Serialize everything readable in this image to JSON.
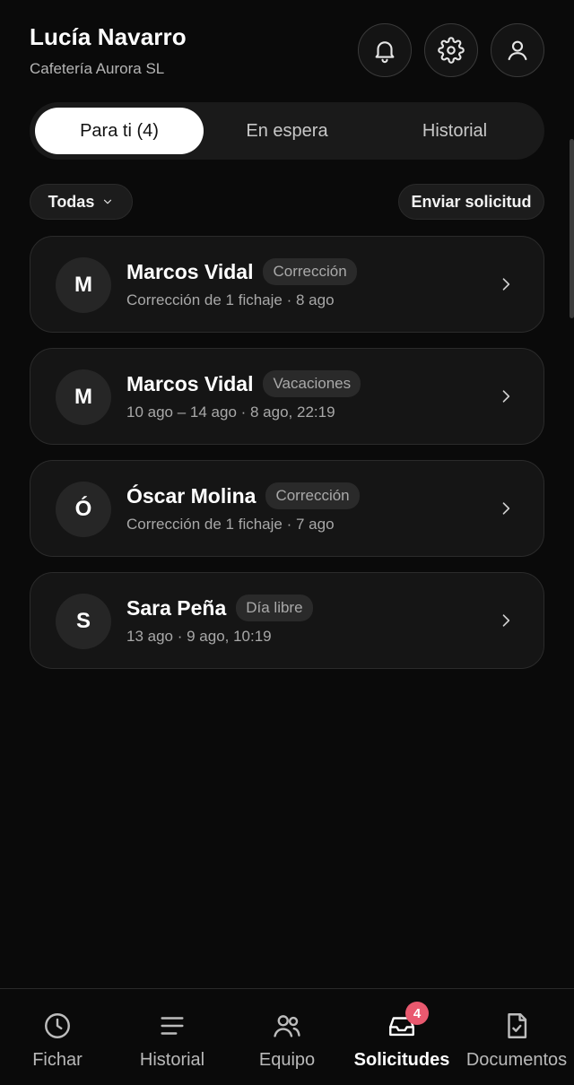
{
  "header": {
    "user_name": "Lucía Navarro",
    "org_name": "Cafetería Aurora SL",
    "icons": [
      "bell-icon",
      "gear-icon",
      "user-icon"
    ]
  },
  "tabs": [
    {
      "label": "Para ti (4)",
      "active": true
    },
    {
      "label": "En espera",
      "active": false
    },
    {
      "label": "Historial",
      "active": false
    }
  ],
  "filter": {
    "label": "Todas"
  },
  "send_request": {
    "label": "Enviar solicitud"
  },
  "requests": [
    {
      "initial": "M",
      "name": "Marcos Vidal",
      "type": "Corrección",
      "detail": "Corrección de 1 fichaje · 8 ago"
    },
    {
      "initial": "M",
      "name": "Marcos Vidal",
      "type": "Vacaciones",
      "detail": "10 ago – 14 ago · 8 ago, 22:19"
    },
    {
      "initial": "Ó",
      "name": "Óscar Molina",
      "type": "Corrección",
      "detail": "Corrección de 1 fichaje · 7 ago"
    },
    {
      "initial": "S",
      "name": "Sara Peña",
      "type": "Día libre",
      "detail": "13 ago · 9 ago, 10:19"
    }
  ],
  "bottom_nav": [
    {
      "label": "Fichar",
      "icon": "clock-icon",
      "active": false
    },
    {
      "label": "Historial",
      "icon": "lines-icon",
      "active": false
    },
    {
      "label": "Equipo",
      "icon": "team-icon",
      "active": false
    },
    {
      "label": "Solicitudes",
      "icon": "inbox-icon",
      "active": true,
      "badge": "4"
    },
    {
      "label": "Documentos",
      "icon": "document-check-icon",
      "active": false
    }
  ],
  "colors": {
    "background": "#0a0a0a",
    "badge": "#e9596f",
    "active_tab": "#ffffff"
  }
}
